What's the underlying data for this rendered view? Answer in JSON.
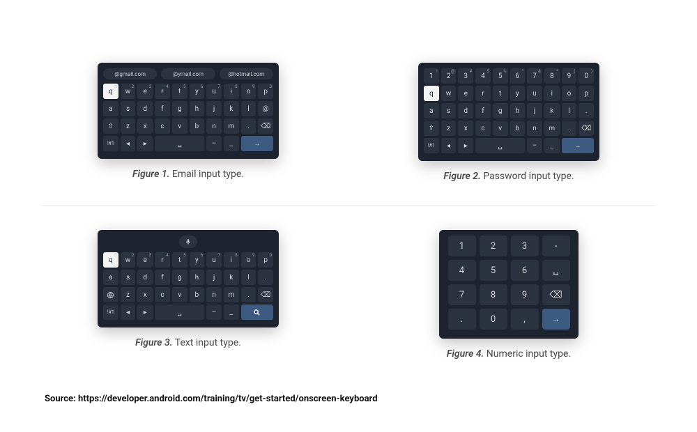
{
  "captions": {
    "fig1_prefix": "Figure 1.",
    "fig1_text": " Email input type.",
    "fig2_prefix": "Figure 2.",
    "fig2_text": " Password input type.",
    "fig3_prefix": "Figure 3.",
    "fig3_text": " Text input type.",
    "fig4_prefix": "Figure 4.",
    "fig4_text": " Numeric input type."
  },
  "source_line": "Source: https://developer.android.com/training/tv/get-started/onscreen-keyboard",
  "email": {
    "suggestions": [
      "@gmail.com",
      "@ymail.com",
      "@hotmail.com"
    ]
  },
  "qwerty": {
    "row1": [
      "q",
      "w",
      "e",
      "r",
      "t",
      "y",
      "u",
      "i",
      "o",
      "p"
    ],
    "row1_sup": [
      "1",
      "2",
      "3",
      "4",
      "5",
      "6",
      "7",
      "8",
      "9",
      "0"
    ],
    "row2": [
      "a",
      "s",
      "d",
      "f",
      "g",
      "h",
      "j",
      "k",
      "l",
      "@"
    ],
    "row2_alt_last": ".",
    "row3_shift": "⇧",
    "row3": [
      "z",
      "x",
      "c",
      "v",
      "b",
      "n",
      "m",
      "."
    ],
    "row3_bksp": "⌫",
    "row4_mode": "!#1",
    "row4_left": "◂",
    "row4_right": "▸",
    "row4_space": "␣",
    "row4_dash": "–",
    "row4_under": "_",
    "row4_enter": "→",
    "row4_search": "🔍"
  },
  "password": {
    "numrow": [
      "1",
      "2",
      "3",
      "4",
      "5",
      "6",
      "7",
      "8",
      "9",
      "0"
    ],
    "numrow_sup": [
      "!",
      "@",
      "#",
      "$",
      "%",
      "^",
      "&",
      "*",
      "(",
      ")"
    ]
  },
  "numeric": {
    "rows": [
      [
        "1",
        "2",
        "3",
        "-"
      ],
      [
        "4",
        "5",
        "6",
        "␣"
      ],
      [
        "7",
        "8",
        "9",
        "⌫"
      ],
      [
        ".",
        "0",
        ",",
        "→"
      ]
    ]
  },
  "colors": {
    "kbd_bg": "#1d2430",
    "key_bg": "#2b3240",
    "action_bg": "#3d5a80",
    "sel_bg": "#f3f3f3"
  }
}
